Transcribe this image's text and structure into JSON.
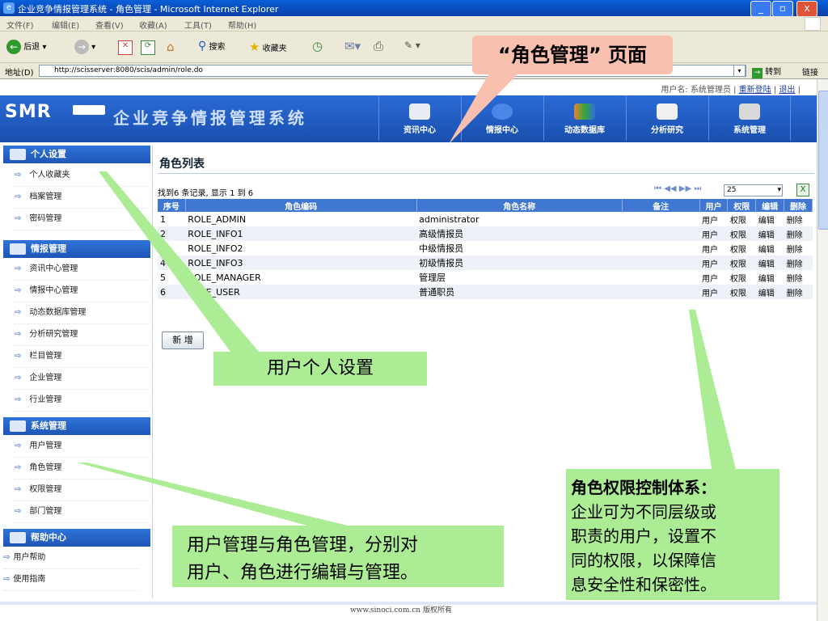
{
  "window": {
    "title": "企业竞争情报管理系统 - 角色管理 - Microsoft Internet Explorer"
  },
  "menubar": [
    "文件(F)",
    "编辑(E)",
    "查看(V)",
    "收藏(A)",
    "工具(T)",
    "帮助(H)"
  ],
  "toolbar": {
    "back": "后退",
    "search": "搜索",
    "favorites": "收藏夹"
  },
  "address": {
    "label": "地址(D)",
    "url": "http://scisserver:8080/scis/admin/role.do",
    "go": "转到",
    "links": "链接"
  },
  "header": {
    "logo": "SMR",
    "system_name": "企业竞争情报管理系统",
    "user_prefix": "用户名: 系统管理员 |",
    "relogin": "重新登陆",
    "sep": "|",
    "logout": "退出",
    "sep2": "|",
    "nav": [
      "资讯中心",
      "情报中心",
      "动态数据库",
      "分析研究",
      "系统管理"
    ]
  },
  "sidebar": {
    "sections": [
      {
        "title": "个人设置",
        "items": [
          "个人收藏夹",
          "档案管理",
          "密码管理"
        ]
      },
      {
        "title": "情报管理",
        "items": [
          "资讯中心管理",
          "情报中心管理",
          "动态数据库管理",
          "分析研究管理",
          "栏目管理",
          "企业管理",
          "行业管理"
        ]
      },
      {
        "title": "系统管理",
        "items": [
          "用户管理",
          "角色管理",
          "权限管理",
          "部门管理"
        ]
      },
      {
        "title": "帮助中心",
        "items": [
          "用户帮助",
          "使用指南"
        ]
      }
    ]
  },
  "main": {
    "title": "角色列表",
    "found_text": "找到6 条记录, 显示 1 到 6",
    "page_size": "25",
    "add_button": "新 增",
    "columns": [
      "序号",
      "角色编码",
      "角色名称",
      "备注",
      "用户",
      "权限",
      "编辑",
      "删除"
    ],
    "rows": [
      {
        "no": "1",
        "code": "ROLE_ADMIN",
        "name": "administrator",
        "note": ""
      },
      {
        "no": "2",
        "code": "ROLE_INFO1",
        "name": "高级情报员",
        "note": ""
      },
      {
        "no": "3",
        "code": "ROLE_INFO2",
        "name": "中级情报员",
        "note": ""
      },
      {
        "no": "4",
        "code": "ROLE_INFO3",
        "name": "初级情报员",
        "note": ""
      },
      {
        "no": "5",
        "code": "ROLE_MANAGER",
        "name": "管理层",
        "note": ""
      },
      {
        "no": "6",
        "code": "ROLE_USER",
        "name": "普通职员",
        "note": ""
      }
    ],
    "row_actions": [
      "用户",
      "权限",
      "编辑",
      "删除"
    ]
  },
  "footer": {
    "copyright": "www.sinoci.com.cn 版权所有"
  },
  "annotations": {
    "page": "“角色管理” 页面",
    "personal": "用户个人设置",
    "users": [
      "用户管理与角色管理，分别对",
      "用户、角色进行编辑与管理。"
    ],
    "perm_title": "角色权限控制体系：",
    "perm_body": [
      "企业可为不同层级或",
      "职责的用户，设置不",
      "同的权限，以保障信",
      "息安全性和保密性。"
    ]
  },
  "colors": {
    "header_blue": "#1e56b6",
    "table_head": "#3f77d2",
    "callout_green": "#acec95",
    "callout_pink": "#f9c0b0"
  }
}
